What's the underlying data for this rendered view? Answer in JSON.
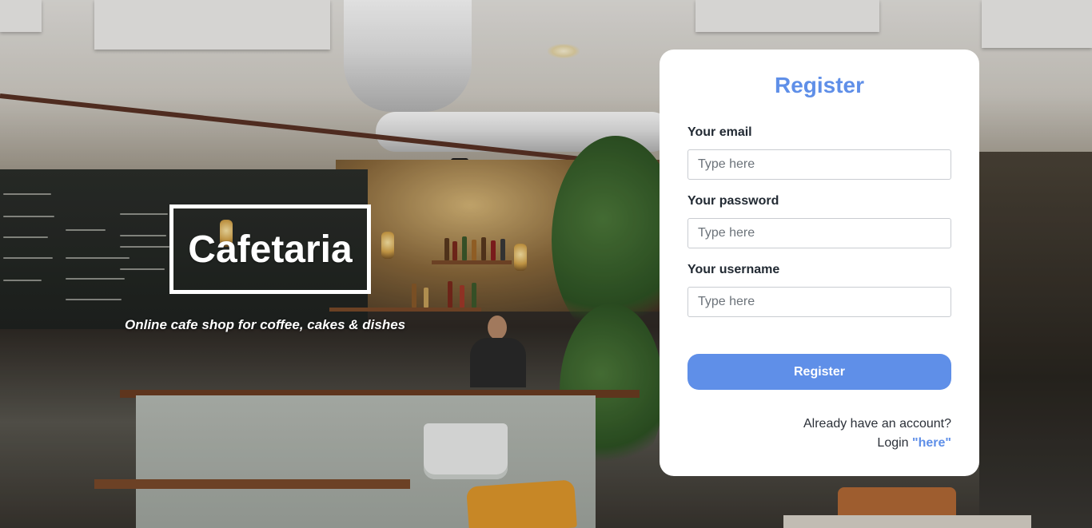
{
  "hero": {
    "title": "Cafetaria",
    "subtitle": "Online cafe shop for coffee, cakes & dishes"
  },
  "register_form": {
    "title": "Register",
    "fields": [
      {
        "label": "Your email",
        "placeholder": "Type here",
        "value": ""
      },
      {
        "label": "Your password",
        "placeholder": "Type here",
        "value": ""
      },
      {
        "label": "Your username",
        "placeholder": "Type here",
        "value": ""
      }
    ],
    "submit_label": "Register",
    "already_text": "Already have an account?",
    "login_prefix": "Login",
    "login_link_text": "\"here\""
  },
  "colors": {
    "accent": "#5f8fe8",
    "card_bg": "#ffffff",
    "label_text": "#222a33"
  },
  "icons": []
}
